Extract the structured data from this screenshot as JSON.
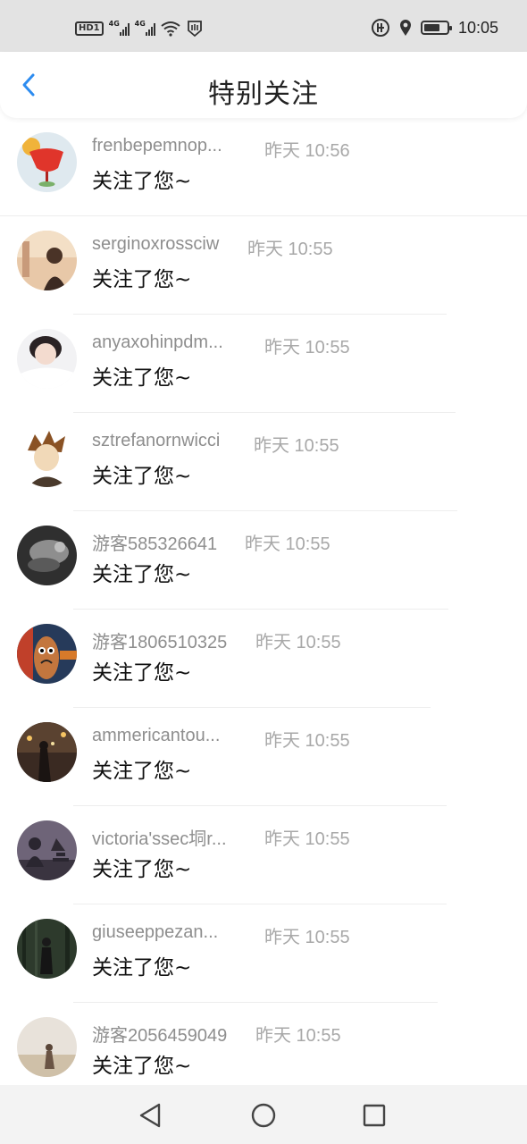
{
  "status_bar": {
    "hd": "HD",
    "sim1": "1",
    "net1": "4G",
    "net2": "4G",
    "time": "10:05"
  },
  "header": {
    "title": "特别关注"
  },
  "items": [
    {
      "name": "frenbepemnop...",
      "time": "昨天 10:56",
      "message": "关注了您~"
    },
    {
      "name": "serginoxrossciw",
      "time": "昨天 10:55",
      "message": "关注了您~"
    },
    {
      "name": "anyaxohinpdm...",
      "time": "昨天 10:55",
      "message": "关注了您~"
    },
    {
      "name": "sztrefanornwicci",
      "time": "昨天 10:55",
      "message": "关注了您~"
    },
    {
      "name": "游客585326641",
      "time": "昨天 10:55",
      "message": "关注了您~"
    },
    {
      "name": "游客1806510325",
      "time": "昨天 10:55",
      "message": "关注了您~"
    },
    {
      "name": "ammericantou...",
      "time": "昨天 10:55",
      "message": "关注了您~"
    },
    {
      "name": "victoria'ssec垌r...",
      "time": "昨天 10:55",
      "message": "关注了您~"
    },
    {
      "name": "giuseeppezan...",
      "time": "昨天 10:55",
      "message": "关注了您~"
    },
    {
      "name": "游客2056459049",
      "time": "昨天 10:55",
      "message": "关注了您~"
    }
  ],
  "colors": {
    "accent": "#2d8cf0",
    "name": "#8e8e8e",
    "time": "#a8a8a8"
  }
}
